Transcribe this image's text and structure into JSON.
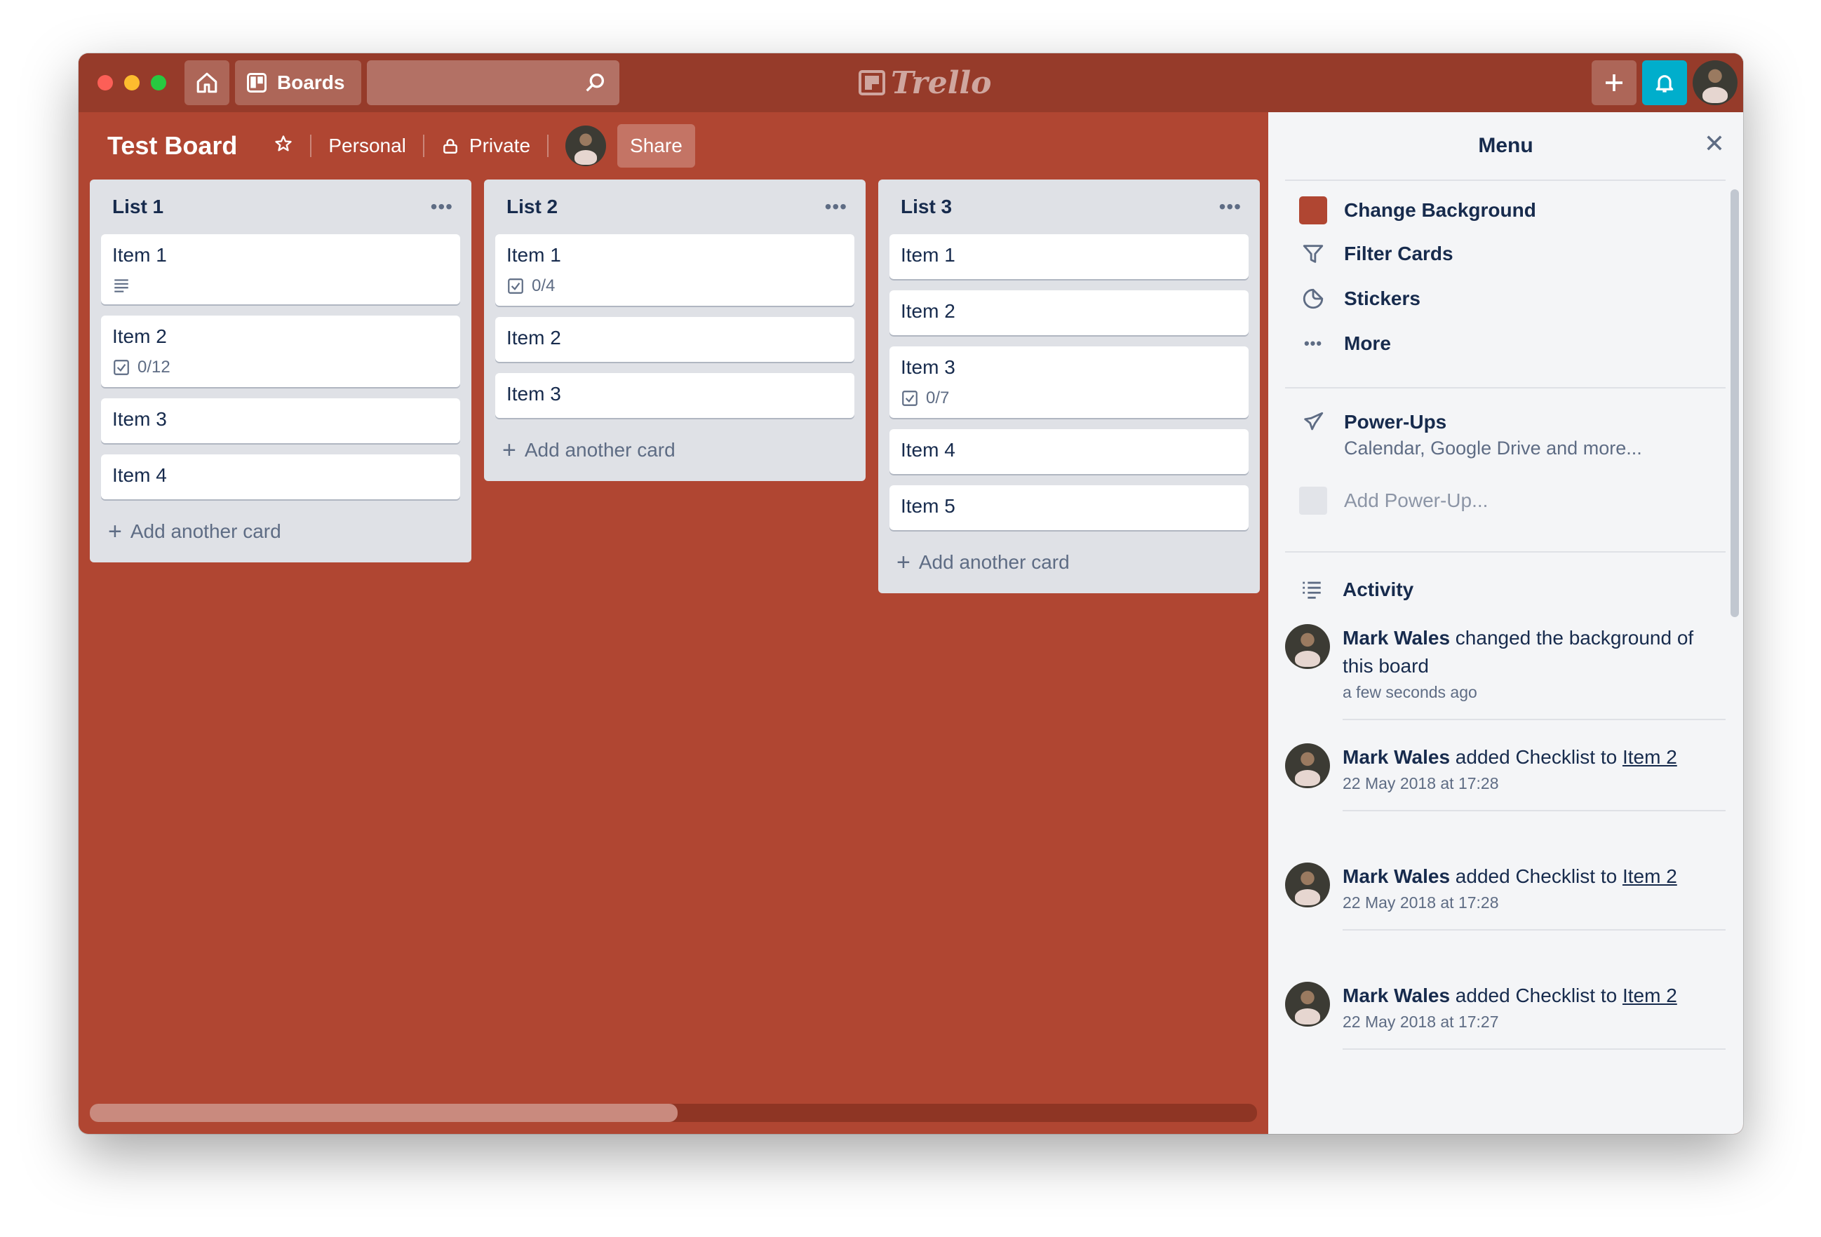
{
  "topbar": {
    "boards_label": "Boards",
    "logo_text": "Trello",
    "search_placeholder": ""
  },
  "board": {
    "title": "Test Board",
    "team": "Personal",
    "visibility": "Private",
    "share_label": "Share"
  },
  "lists": [
    {
      "title": "List 1",
      "cards": [
        {
          "title": "Item 1",
          "badge": "description"
        },
        {
          "title": "Item 2",
          "checklist": "0/12"
        },
        {
          "title": "Item 3"
        },
        {
          "title": "Item 4"
        }
      ],
      "add_label": "Add another card"
    },
    {
      "title": "List 2",
      "cards": [
        {
          "title": "Item 1",
          "checklist": "0/4"
        },
        {
          "title": "Item 2"
        },
        {
          "title": "Item 3"
        }
      ],
      "add_label": "Add another card"
    },
    {
      "title": "List 3",
      "cards": [
        {
          "title": "Item 1"
        },
        {
          "title": "Item 2"
        },
        {
          "title": "Item 3",
          "checklist": "0/7"
        },
        {
          "title": "Item 4"
        },
        {
          "title": "Item 5"
        }
      ],
      "add_label": "Add another card"
    }
  ],
  "menu": {
    "title": "Menu",
    "items": [
      {
        "label": "Change Background",
        "icon": "background-swatch"
      },
      {
        "label": "Filter Cards",
        "icon": "filter-icon"
      },
      {
        "label": "Stickers",
        "icon": "sticker-icon"
      },
      {
        "label": "More",
        "icon": "more-icon"
      }
    ],
    "powerups": {
      "title": "Power-Ups",
      "subtitle": "Calendar, Google Drive and more...",
      "add_label": "Add Power-Up..."
    },
    "activity_title": "Activity",
    "activity": [
      {
        "who": "Mark Wales",
        "action": " changed the background of this board",
        "link": "",
        "time": "a few seconds ago"
      },
      {
        "who": "Mark Wales",
        "action": " added Checklist to ",
        "link": "Item 2",
        "time": "22 May 2018 at 17:28"
      },
      {
        "who": "Mark Wales",
        "action": " added Checklist to ",
        "link": "Item 2",
        "time": "22 May 2018 at 17:28"
      },
      {
        "who": "Mark Wales",
        "action": " added Checklist to ",
        "link": "Item 2",
        "time": "22 May 2018 at 17:27"
      }
    ]
  },
  "colors": {
    "board_background": "#b04632",
    "header": "#963b2a",
    "notification_button": "#00aecc"
  }
}
